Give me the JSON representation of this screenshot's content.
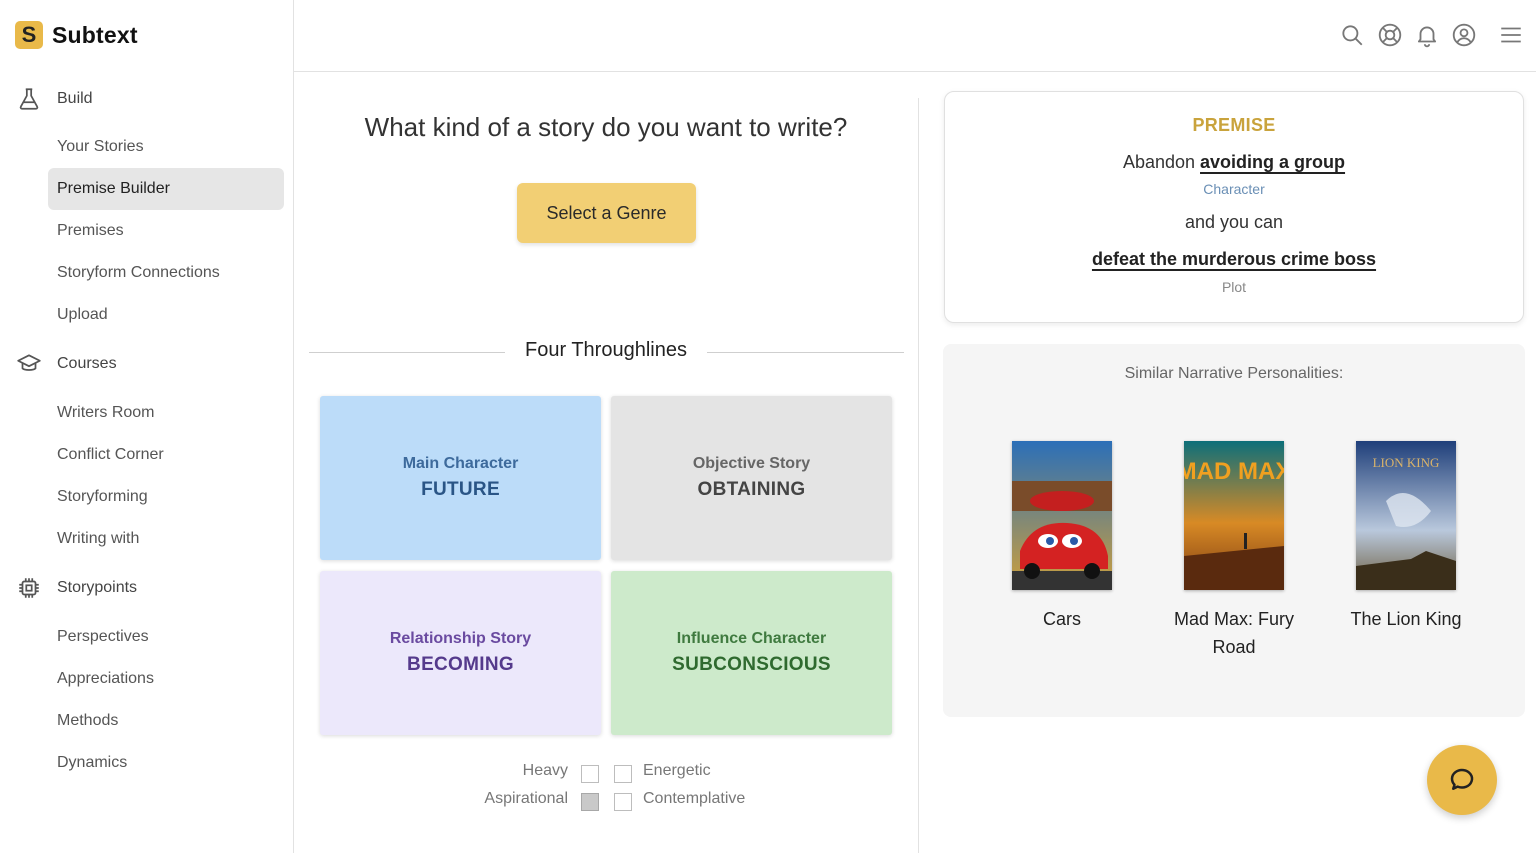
{
  "app": {
    "name": "Subtext",
    "logo_letter": "S",
    "accent": "#e9b949"
  },
  "sidebar": {
    "sections": [
      {
        "label": "Build",
        "icon": "flask-icon",
        "items": [
          "Your Stories",
          "Premise Builder",
          "Premises",
          "Storyform Connections",
          "Upload"
        ]
      },
      {
        "label": "Courses",
        "icon": "graduation-cap-icon",
        "items": [
          "Writers Room",
          "Conflict Corner",
          "Storyforming",
          "Writing with"
        ]
      },
      {
        "label": "Storypoints",
        "icon": "chip-icon",
        "items": [
          "Perspectives",
          "Appreciations",
          "Methods",
          "Dynamics"
        ]
      }
    ],
    "active_item": "Premise Builder"
  },
  "topbar": {
    "icons": [
      "search-icon",
      "help-icon",
      "bell-icon",
      "account-icon",
      "menu-icon"
    ]
  },
  "main": {
    "question": "What kind of a story do you want to write?",
    "genre_button": "Select a Genre",
    "throughlines_title": "Four Throughlines",
    "throughlines": [
      {
        "label": "Main Character",
        "value": "FUTURE",
        "bg": "#bcdcf9",
        "fg": "#3d6a9c",
        "fg_value": "#2a5586"
      },
      {
        "label": "Objective Story",
        "value": "OBTAINING",
        "bg": "#e4e4e4",
        "fg": "#666666",
        "fg_value": "#444444"
      },
      {
        "label": "Relationship Story",
        "value": "BECOMING",
        "bg": "#ece8fb",
        "fg": "#6a4aa0",
        "fg_value": "#553a8c"
      },
      {
        "label": "Influence Character",
        "value": "SUBCONSCIOUS",
        "bg": "#cdeacb",
        "fg": "#3f7a3f",
        "fg_value": "#2f6a2f"
      }
    ],
    "traits": [
      {
        "left": "Heavy",
        "left_checked": false,
        "right": "Energetic",
        "right_checked": false
      },
      {
        "left": "Aspirational",
        "left_checked": true,
        "right": "Contemplative",
        "right_checked": false
      }
    ]
  },
  "premise": {
    "heading": "PREMISE",
    "line1_prefix": "Abandon",
    "line1_bold": "avoiding a group",
    "character_label": "Character",
    "connector": "and you can",
    "plot_text": "defeat the murderous crime boss",
    "plot_label": "Plot"
  },
  "similar": {
    "title": "Similar Narrative Personalities:",
    "movies": [
      {
        "title": "Cars"
      },
      {
        "title": "Mad Max: Fury Road",
        "poster_text": "MAD MAX"
      },
      {
        "title": "The Lion King",
        "poster_text": "LION KING"
      }
    ]
  }
}
